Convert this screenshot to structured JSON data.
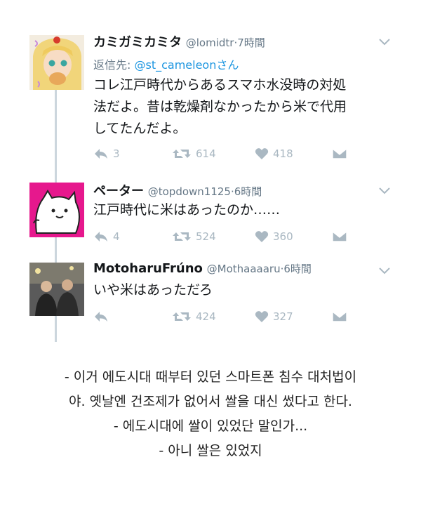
{
  "tweets": [
    {
      "name": "カミガミカミタ",
      "handle": "@lomidtr",
      "time": "7時間",
      "reply_label": "返信先:",
      "reply_mention": "@st_cameleon",
      "reply_suffix": "さん",
      "text_lines": [
        "コレ江戸時代からあるスマホ水没時の対処",
        "法だよ。昔は乾燥剤なかったから米で代用",
        "してたんだよ。"
      ],
      "replies": "3",
      "retweets": "614",
      "likes": "418"
    },
    {
      "name": "ペーター",
      "handle": "@topdown1125",
      "time": "6時間",
      "text_lines": [
        "江戸時代に米はあったのか……"
      ],
      "replies": "4",
      "retweets": "524",
      "likes": "360"
    },
    {
      "name": "MotoharuFrúno",
      "handle": "@Mothaaaaru",
      "time": "6時間",
      "text_lines": [
        "いや米はあっただろ"
      ],
      "replies": "",
      "retweets": "424",
      "likes": "327"
    }
  ],
  "separator": "·",
  "caption_lines": [
    "- 이거 에도시대 때부터 있던 스마트폰 침수 대처법이",
    "야. 옛날엔 건조제가 없어서 쌀을 대신 썼다고 한다.",
    "- 에도시대에 쌀이 있었단 말인가...",
    "- 아니 쌀은 있었지"
  ],
  "colors": {
    "link": "#1b95e0",
    "muted": "#657786",
    "icon": "#aab8c2",
    "thread_line": "#ccd6dd"
  },
  "icons": [
    "reply-icon",
    "retweet-icon",
    "like-icon",
    "message-icon",
    "chevron-down-icon"
  ]
}
